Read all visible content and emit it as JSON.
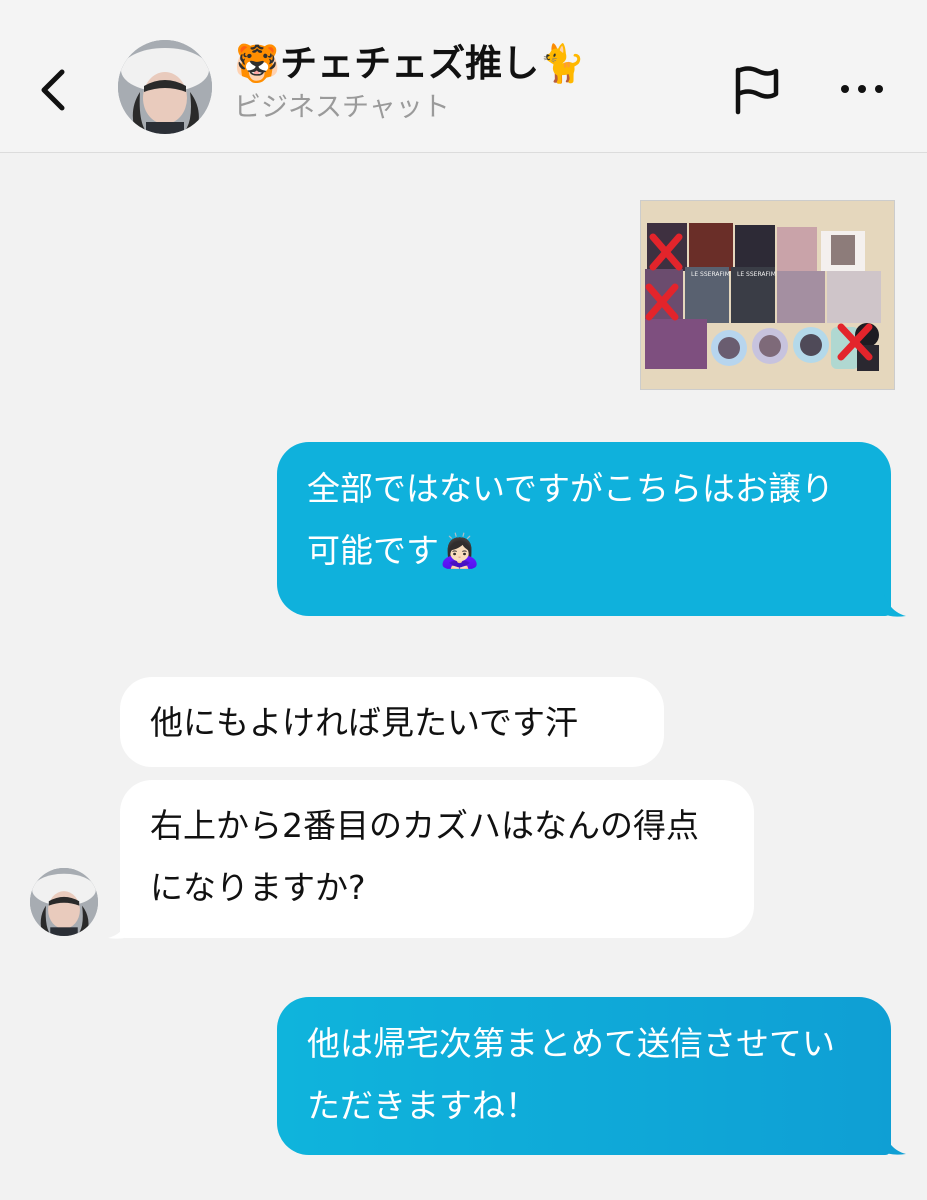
{
  "header": {
    "title": "🐯チェチェズ推し🐈",
    "subtitle": "ビジネスチャット",
    "back_icon": "chevron-left-icon",
    "flag_icon": "flag-icon",
    "more_icon": "more-dots-icon"
  },
  "photo": {
    "logos": [
      "LE SSERAFIM",
      "LE SSERAFIM"
    ]
  },
  "messages": {
    "m1": "全部ではないですがこちらはお譲り可能です🙇🏻‍♀️",
    "m2": "他にもよければ見たいです汗",
    "m3": "右上から2番目のカズハはなんの得点になりますか?",
    "m4": "他は帰宅次第まとめて送信させていただきますね！"
  },
  "colors": {
    "outgoing_bubble": "#0fb1dc",
    "incoming_bubble": "#ffffff",
    "background": "#f2f2f2"
  }
}
